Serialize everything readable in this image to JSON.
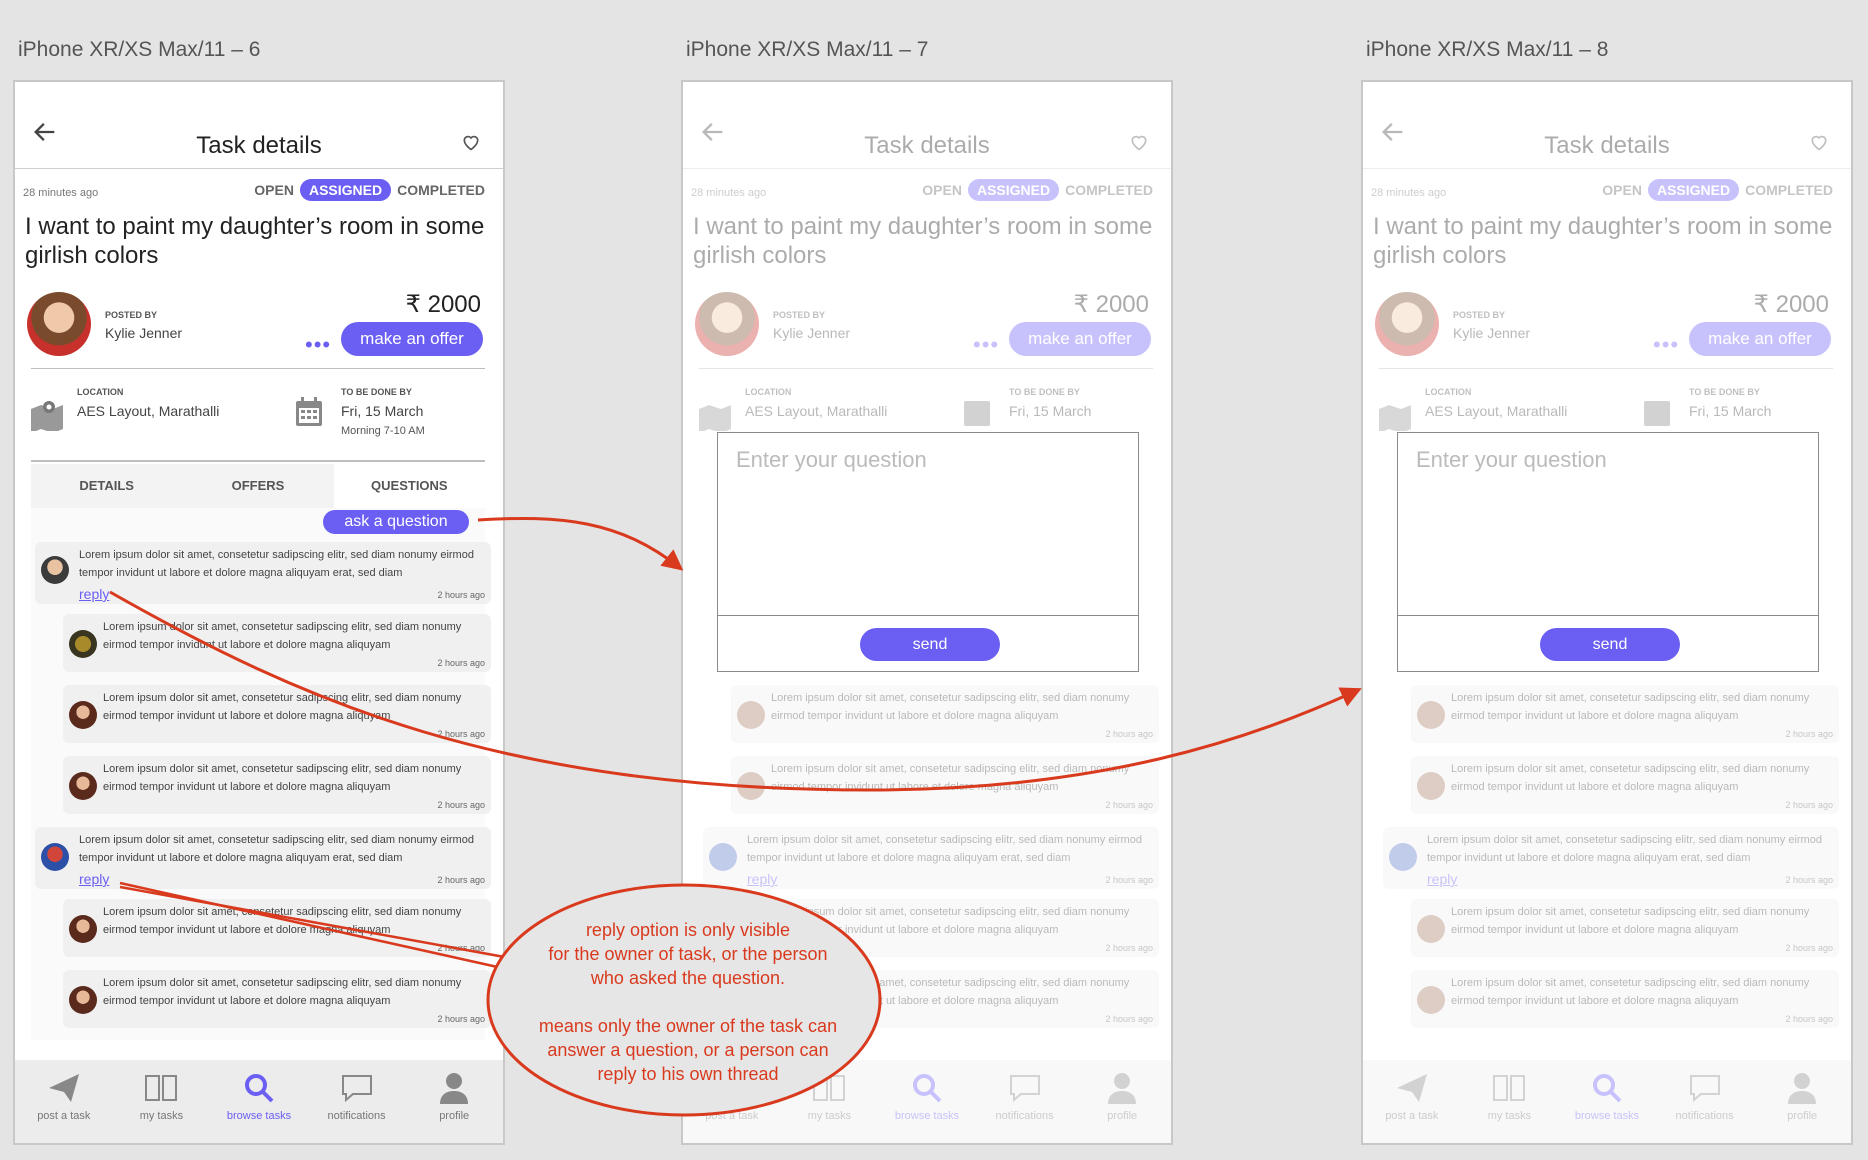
{
  "artboards": [
    "iPhone XR/XS Max/11 – 6",
    "iPhone XR/XS Max/11 – 7",
    "iPhone XR/XS Max/11 – 8"
  ],
  "header": {
    "title": "Task details"
  },
  "task": {
    "posted_ago": "28 minutes ago",
    "status": {
      "open": "OPEN",
      "assigned": "ASSIGNED",
      "completed": "COMPLETED"
    },
    "title": "I want to paint my daughter’s room in some girlish colors",
    "posted_by_label": "POSTED BY",
    "poster_name": "Kylie Jenner",
    "price": "₹ 2000",
    "more": "•••",
    "offer_button": "make an offer",
    "location_label": "LOCATION",
    "location": "AES Layout, Marathalli",
    "due_label": "TO BE DONE BY",
    "due_date": "Fri, 15 March",
    "due_time": "Morning 7-10 AM"
  },
  "tabs": [
    "DETAILS",
    "OFFERS",
    "QUESTIONS"
  ],
  "ask_button": "ask a question",
  "questions": {
    "q1": "Lorem ipsum dolor sit amet, consetetur sadipscing elitr, sed diam nonumy eirmod tempor invidunt ut labore et dolore magna aliquyam erat, sed diam",
    "r1": "Lorem ipsum dolor sit amet, consetetur sadipscing elitr, sed diam nonumy eirmod tempor invidunt ut labore et dolore magna aliquyam",
    "time": "2 hours ago",
    "reply": "reply"
  },
  "nav": [
    "post a task",
    "my tasks",
    "browse tasks",
    "notifications",
    "profile"
  ],
  "dialog": {
    "placeholder": "Enter your question",
    "send": "send"
  },
  "annotation": {
    "l1": "reply option is only visible",
    "l2": "for the owner of task, or the person",
    "l3": "who asked the question.",
    "l4": "means only the owner of the task can",
    "l5": "answer a question, or a person can",
    "l6": "reply to his own thread"
  },
  "colors": {
    "accent": "#6b5ff3",
    "annotation": "#d93a1e"
  }
}
